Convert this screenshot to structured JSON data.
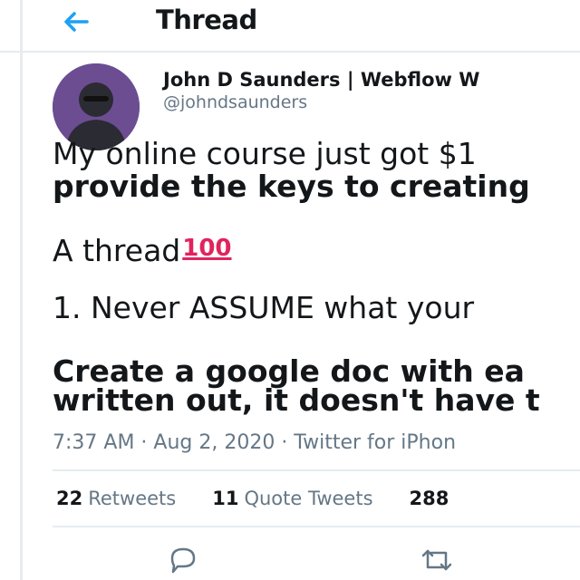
{
  "header": {
    "title": "Thread"
  },
  "tweet": {
    "author_name": "John D Saunders | Webflow W",
    "author_handle": "@johndsaunders",
    "lines": [
      "My online course just got $1",
      "provide the keys to creating",
      "A thread",
      "1. Never ASSUME what your",
      "Create a google doc with ea",
      "written out, it doesn't have t"
    ],
    "emoji_text": "100",
    "meta": "7:37 AM · Aug 2, 2020 · Twitter for iPhon"
  },
  "stats": {
    "retweets_count": "22",
    "retweets_label": "Retweets",
    "quotes_count": "11",
    "quotes_label": "Quote Tweets",
    "likes_count": "288"
  },
  "icons": {
    "back": "arrow-left-icon",
    "reply": "reply-icon",
    "retweet": "retweet-icon"
  },
  "colors": {
    "accent": "#1da1f2",
    "avatar_bg": "#6c4d92",
    "emoji": "#e0245e"
  }
}
